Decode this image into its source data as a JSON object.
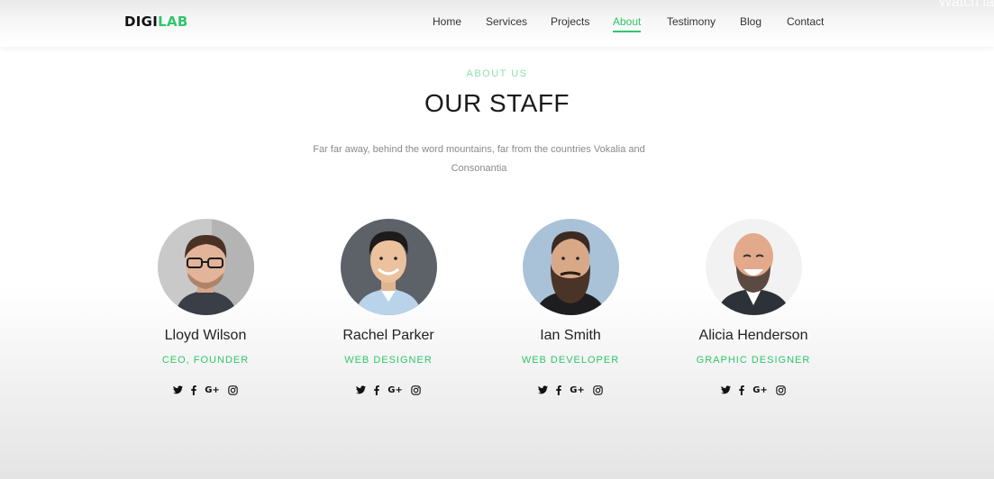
{
  "brand": {
    "part1": "DIGI",
    "part2": "LAB"
  },
  "nav": {
    "items": [
      {
        "label": "Home",
        "active": false
      },
      {
        "label": "Services",
        "active": false
      },
      {
        "label": "Projects",
        "active": false
      },
      {
        "label": "About",
        "active": true
      },
      {
        "label": "Testimony",
        "active": false
      },
      {
        "label": "Blog",
        "active": false
      },
      {
        "label": "Contact",
        "active": false
      }
    ]
  },
  "overlay": {
    "watch_text": "Watch la"
  },
  "section": {
    "subheading": "ABOUT US",
    "heading": "OUR STAFF",
    "description": "Far far away, behind the word mountains, far from the countries Vokalia and Consonantia"
  },
  "staff": [
    {
      "name": "Lloyd Wilson",
      "role": "CEO, FOUNDER",
      "photo": "man-with-glasses"
    },
    {
      "name": "Rachel Parker",
      "role": "WEB DESIGNER",
      "photo": "smiling-man-blue-shirt"
    },
    {
      "name": "Ian Smith",
      "role": "WEB DEVELOPER",
      "photo": "bearded-man"
    },
    {
      "name": "Alicia Henderson",
      "role": "GRAPHIC DESIGNER",
      "photo": "laughing-bald-man"
    }
  ],
  "social_icons": {
    "twitter": "twitter-icon",
    "facebook": "facebook-icon",
    "google_plus": "google-plus-icon",
    "google_plus_glyph": "G+",
    "instagram": "instagram-icon"
  },
  "colors": {
    "accent": "#2fc66b",
    "subheading": "#8fe0ae",
    "text_dark": "#222222",
    "text_muted": "#8a8a8a"
  }
}
